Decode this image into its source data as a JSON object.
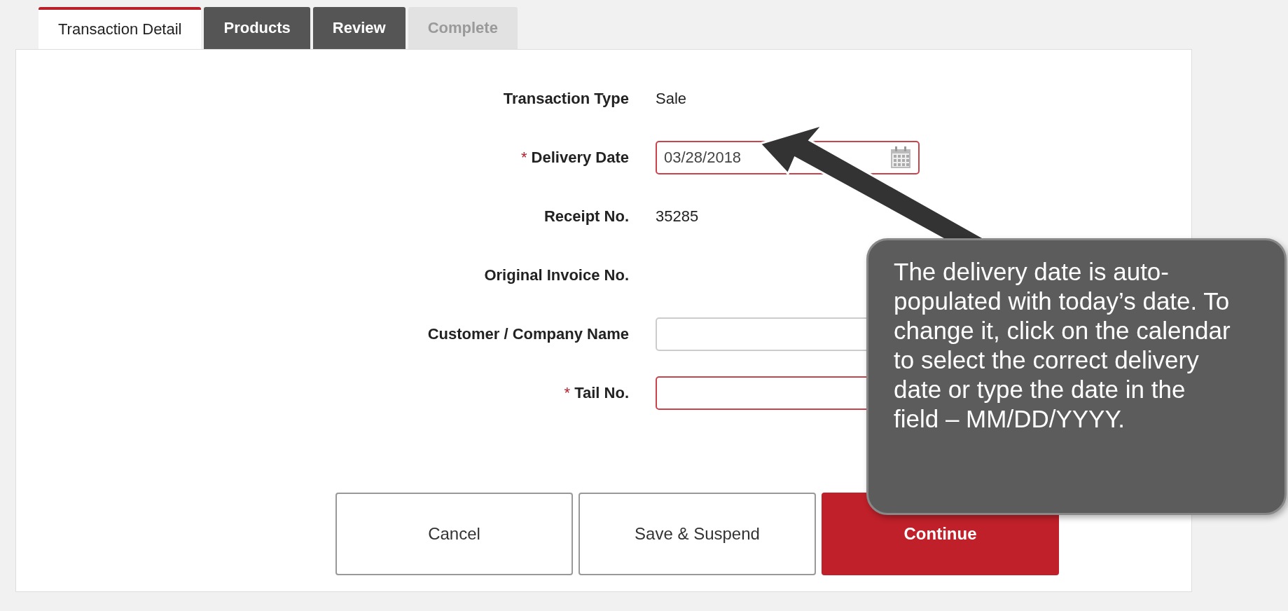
{
  "tabs": [
    {
      "label": "Transaction Detail",
      "selected": true,
      "disabled": false
    },
    {
      "label": "Products",
      "selected": false,
      "disabled": false
    },
    {
      "label": "Review",
      "selected": false,
      "disabled": false
    },
    {
      "label": "Complete",
      "selected": false,
      "disabled": true
    }
  ],
  "fields": [
    {
      "kind": "text",
      "label": "Transaction Type",
      "required": false,
      "value": "Sale"
    },
    {
      "kind": "date",
      "label": "Delivery Date",
      "required": true,
      "value": "03/28/2018"
    },
    {
      "kind": "text",
      "label": "Receipt No.",
      "required": false,
      "value": "35285"
    },
    {
      "kind": "text",
      "label": "Original Invoice No.",
      "required": false
    },
    {
      "kind": "input",
      "label": "Customer / Company Name",
      "required": false
    },
    {
      "kind": "input",
      "label": "Tail No.",
      "required": true
    }
  ],
  "required_mark": "*",
  "buttons": [
    {
      "label": "Cancel",
      "kind": "secondary"
    },
    {
      "label": "Save & Suspend",
      "kind": "secondary"
    },
    {
      "label": "Continue",
      "kind": "primary"
    }
  ],
  "callout": {
    "text": "The delivery date is auto-populated with today’s date. To change it, click on the calendar to select the correct delivery date or type the date in the field – MM/DD/YYYY."
  }
}
